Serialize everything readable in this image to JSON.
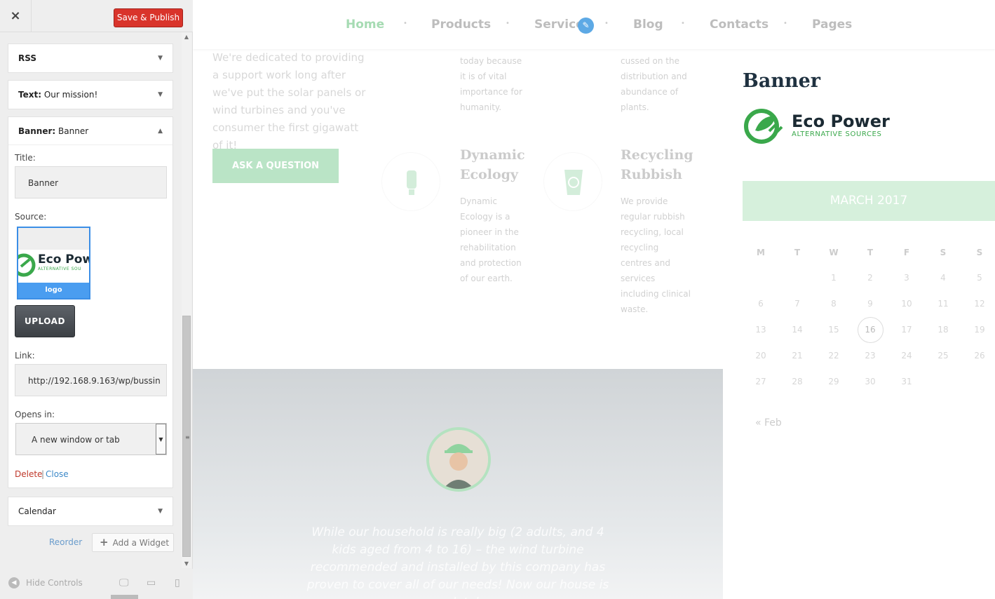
{
  "sidebar": {
    "close_icon": "×",
    "save_label": "Save & Publish",
    "widgets": [
      {
        "type": "RSS",
        "name": ""
      },
      {
        "type": "Text:",
        "name": "Our mission!"
      },
      {
        "type": "Banner:",
        "name": "Banner"
      },
      {
        "type": "Calendar",
        "name": ""
      }
    ],
    "banner_form": {
      "title_label": "Title:",
      "title_value": "Banner",
      "source_label": "Source:",
      "thumb_logo_text": "Eco Pow",
      "thumb_logo_sub": "ALTERNATIVE SOU",
      "thumb_caption": "logo",
      "upload_label": "UPLOAD",
      "link_label": "Link:",
      "link_value": "http://192.168.9.163/wp/bussin",
      "opens_label": "Opens in:",
      "opens_value": "A new window or tab",
      "delete_label": "Delete",
      "separator": "|",
      "close_label": "Close"
    },
    "reorder_label": "Reorder",
    "add_widget_label": "Add a Widget",
    "hide_controls_label": "Hide Controls"
  },
  "preview": {
    "nav": [
      "Home",
      "Products",
      "Service",
      "Blog",
      "Contacts",
      "Pages"
    ],
    "active_nav": "Home",
    "intro_text": "We're dedicated to providing a support work long after we've put the solar panels or wind turbines and you've consumer the first gigawatt of it!",
    "ask_button": "ASK A QUESTION",
    "col1_top": "today because it is of vital importance for humanity.",
    "col2_top": "cussed on the distribution and abundance of plants.",
    "feature1_title": "Dynamic Ecology",
    "feature1_text": "Dynamic Ecology is a pioneer in the rehabilitation and protection of our earth.",
    "feature2_title": "Recycling Rubbish",
    "feature2_text": "We provide regular rubbish recycling, local recycling centres and services including clinical waste.",
    "quote": "While our household is really big (2 adults, and 4 kids aged from 4 to 16) – the wind turbine recommended and installed by this company has proven to cover all of our needs! Now our house is completely...",
    "banner_widget_title": "Banner",
    "logo_main": "Eco Power",
    "logo_sub": "ALTERNATIVE SOURCES",
    "calendar": {
      "month": "MARCH 2017",
      "days_of_week": [
        "M",
        "T",
        "W",
        "T",
        "F",
        "S",
        "S"
      ],
      "weeks": [
        [
          "",
          "",
          "1",
          "2",
          "3",
          "4",
          "5"
        ],
        [
          "6",
          "7",
          "8",
          "9",
          "10",
          "11",
          "12"
        ],
        [
          "13",
          "14",
          "15",
          "16",
          "17",
          "18",
          "19"
        ],
        [
          "20",
          "21",
          "22",
          "23",
          "24",
          "25",
          "26"
        ],
        [
          "27",
          "28",
          "29",
          "30",
          "31",
          "",
          ""
        ]
      ],
      "today": "16",
      "prev_link": "« Feb"
    }
  },
  "colors": {
    "save_button": "#d9342b",
    "link_blue": "#3e8ac9",
    "delete_red": "#c0392b",
    "brand_green": "#3aa84b",
    "calendar_header": "#d6f0dc"
  }
}
